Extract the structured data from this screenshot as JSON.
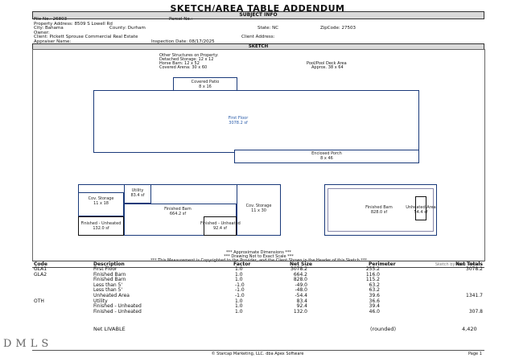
{
  "title": "SKETCH/AREA TABLE ADDENDUM",
  "subject_header": "SUBJECT INFO",
  "subject": {
    "file_no": "File No.: 26803",
    "parcel_no": "Parcel No.:",
    "address": "Property Address: 8509 S Lowell Rd",
    "city": "City: Bahama",
    "county": "County: Durham",
    "state": "State: NC",
    "zip": "ZipCode: 27503",
    "owner": "Owner:",
    "client": "Client: Pickett Sprouse Commercial Real Estate",
    "client_address": "Client Address:",
    "appraiser": "Appraiser Name:",
    "inspection": "Inspection Date: 08/17/2025"
  },
  "sketch_header": "SKETCH",
  "notes": {
    "other_title": "Other Structures on Property:",
    "other_1": "Detached Storage: 12 x 12",
    "other_2": "Horse Barn: 12 x 52",
    "other_3": "Covered Arena: 30 x 60",
    "pool_1": "Pool/Pool Deck Area",
    "pool_2": "Approx. 38 x 64",
    "approx": "*** Approximate Dimensions ***",
    "drawing": "*** Drawing Not to Exact Scale ***",
    "copyright": "*** This Measurement is Copyrighted to the Provider, and the Client Shown in the Header of this Sketch ***",
    "apex": "Sketch by Apex Sketch"
  },
  "rooms": {
    "covered_patio": "Covered Patio",
    "covered_patio_dim": "8 x 16",
    "first_floor": "First Floor",
    "first_floor_sf": "3078.2 sf",
    "enclosed_porch": "Enclosed Porch",
    "enclosed_porch_dim": "8 x 46",
    "utility": "Utility",
    "utility_sf": "83.4 sf",
    "cov_storage_left": "Cov. Storage",
    "cov_storage_left_dim": "11 x 18",
    "finished_barn": "Finished Barn",
    "finished_barn_sf": "664.2 sf",
    "cov_storage_right": "Cov. Storage",
    "cov_storage_right_dim": "11 x 30",
    "fin_unheated_left": "Finished - Unheated",
    "fin_unheated_left_sf": "132.0 sf",
    "fin_unheated_mid": "Finished - Unheated",
    "fin_unheated_mid_sf": "92.4 sf",
    "finished_barn_2": "Finished Barn",
    "finished_barn_2_sf": "828.0 sf",
    "unheated_area": "Unheated Area",
    "unheated_area_sf": "54.4 sf"
  },
  "table": {
    "headers": [
      "Code",
      "Description",
      "Factor",
      "Net Size",
      "Perimeter",
      "Net Totals"
    ],
    "rows": [
      {
        "code": "GLA1",
        "desc": "First Floor",
        "factor": "1.0",
        "net": "3078.2",
        "perim": "255.2",
        "total": "3078.2"
      },
      {
        "code": "GLA2",
        "desc": "Finished Barn",
        "factor": "1.0",
        "net": "664.2",
        "perim": "116.0",
        "total": ""
      },
      {
        "code": "",
        "desc": "Finished Barn",
        "factor": "1.0",
        "net": "828.0",
        "perim": "115.2",
        "total": ""
      },
      {
        "code": "",
        "desc": "Less than 5'",
        "factor": "-1.0",
        "net": "-49.0",
        "perim": "63.2",
        "total": ""
      },
      {
        "code": "",
        "desc": "Less than 5'",
        "factor": "-1.0",
        "net": "-48.0",
        "perim": "63.2",
        "total": ""
      },
      {
        "code": "",
        "desc": "Unheated Area",
        "factor": "-1.0",
        "net": "-54.4",
        "perim": "39.6",
        "total": "1341.7"
      },
      {
        "code": "OTH",
        "desc": "Utility",
        "factor": "1.0",
        "net": "83.4",
        "perim": "36.6",
        "total": ""
      },
      {
        "code": "",
        "desc": "Finished - Unheated",
        "factor": "1.0",
        "net": "92.4",
        "perim": "39.4",
        "total": ""
      },
      {
        "code": "",
        "desc": "Finished - Unheated",
        "factor": "1.0",
        "net": "132.0",
        "perim": "46.0",
        "total": "307.8"
      }
    ],
    "net_livable_label": "Net LIVABLE",
    "rounded_label": "(rounded)",
    "net_livable_value": "4,420"
  },
  "footer": {
    "copyright": "© Starcap Marketing, LLC. dba Apex Software",
    "page": "Page 1"
  },
  "logo_text": "DMLS"
}
